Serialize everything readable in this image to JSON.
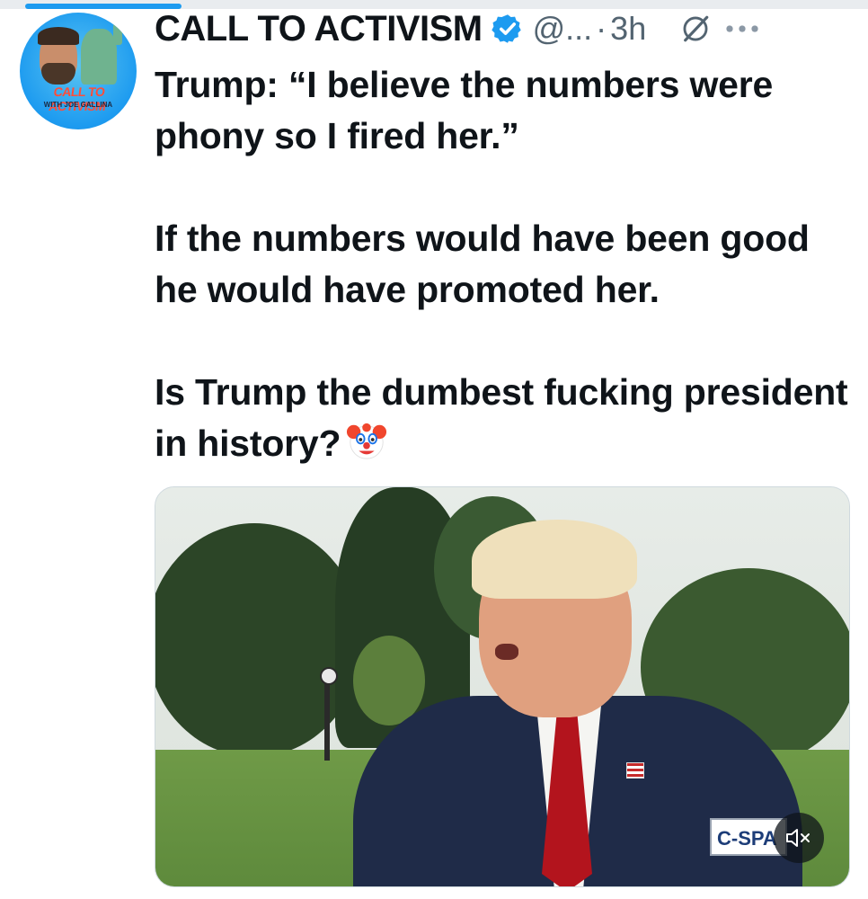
{
  "app": {
    "view": "post-detail",
    "accent_color": "#1d9bf0",
    "media_progress": 0.18
  },
  "author": {
    "display_name": "CALL TO ACTIVISM",
    "handle": "@...",
    "separator": "·",
    "timestamp": "3h",
    "verified": true,
    "verified_color": "#1d9bf0",
    "avatar": {
      "logo_line1": "CALL TO ACTIVISM",
      "logo_line2": "WITH JOE GALLINA",
      "background": "#1d9bf0"
    }
  },
  "post": {
    "paragraph_1": "Trump: “I believe the numbers were phony so I fired her.”",
    "paragraph_2": "If the numbers would have been good he would have promoted her.",
    "paragraph_3": "Is Trump the dumbest fucking president in history?",
    "emoji": "clown-face"
  },
  "media": {
    "type": "video",
    "watermark": "C-SPAN",
    "watermark_visible": "C-SPA",
    "muted": true,
    "mute_icon": "speaker-muted-icon"
  },
  "icons": {
    "verified": "verified-badge-icon",
    "grok": "grok-icon",
    "more": "more-horizontal-icon"
  }
}
